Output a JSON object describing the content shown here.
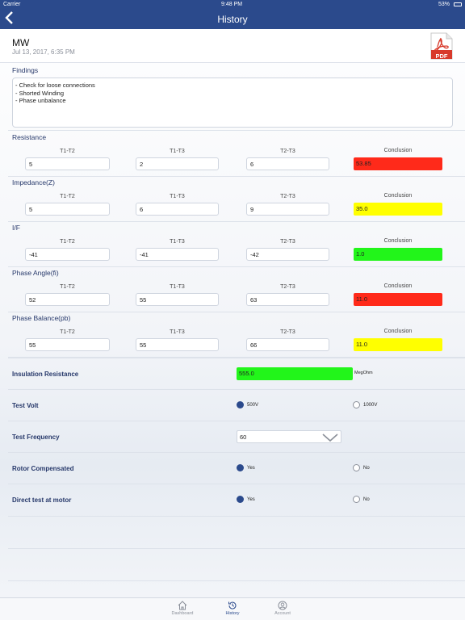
{
  "status_bar": {
    "carrier": "Carrier",
    "time": "9:48 PM",
    "battery": "53%"
  },
  "nav": {
    "title": "History",
    "back_icon": "chevron-left-icon"
  },
  "header": {
    "name": "MW",
    "date": "Jul 13, 2017, 6:35 PM",
    "pdf_label": "PDF"
  },
  "findings": {
    "label": "Findings",
    "lines": [
      "- Check for loose connections",
      "- Shorted Winding",
      "- Phase unbalance"
    ]
  },
  "columns": {
    "t1t2": "T1-T2",
    "t1t3": "T1-T3",
    "t2t3": "T2-T3",
    "conclusion": "Conclusion"
  },
  "colors": {
    "red": "#ff2a1a",
    "yellow": "#ffff00",
    "green": "#22f51a",
    "accent": "#2b4a8c"
  },
  "measurements": [
    {
      "label": "Resistance",
      "t1t2": "5",
      "t1t3": "2",
      "t2t3": "6",
      "conclusion": "53.85",
      "status": "red"
    },
    {
      "label": "Impedance(Z)",
      "t1t2": "5",
      "t1t3": "6",
      "t2t3": "9",
      "conclusion": "35.0",
      "status": "yellow"
    },
    {
      "label": "I/F",
      "t1t2": "-41",
      "t1t3": "-41",
      "t2t3": "-42",
      "conclusion": "1.0",
      "status": "green"
    },
    {
      "label": "Phase Angle(fi)",
      "t1t2": "52",
      "t1t3": "55",
      "t2t3": "63",
      "conclusion": "11.0",
      "status": "red"
    },
    {
      "label": "Phase Balance(pb)",
      "t1t2": "55",
      "t1t3": "55",
      "t2t3": "66",
      "conclusion": "11.0",
      "status": "yellow"
    }
  ],
  "insulation": {
    "label": "Insulation Resistance",
    "value": "555.0",
    "unit": "MegOhm",
    "status": "green"
  },
  "test_volt": {
    "label": "Test Volt",
    "option1": "500V",
    "option2": "1000V",
    "selected": "500V"
  },
  "test_frequency": {
    "label": "Test Frequency",
    "value": "60"
  },
  "rotor_compensated": {
    "label": "Rotor Compensated",
    "yes": "Yes",
    "no": "No",
    "selected": "Yes"
  },
  "direct_test": {
    "label": "Direct test at motor",
    "yes": "Yes",
    "no": "No",
    "selected": "Yes"
  },
  "tab_bar": {
    "tabs": [
      {
        "label": "Dashboard",
        "icon": "home-icon",
        "active": false
      },
      {
        "label": "History",
        "icon": "history-icon",
        "active": true
      },
      {
        "label": "Account",
        "icon": "account-icon",
        "active": false
      }
    ]
  }
}
